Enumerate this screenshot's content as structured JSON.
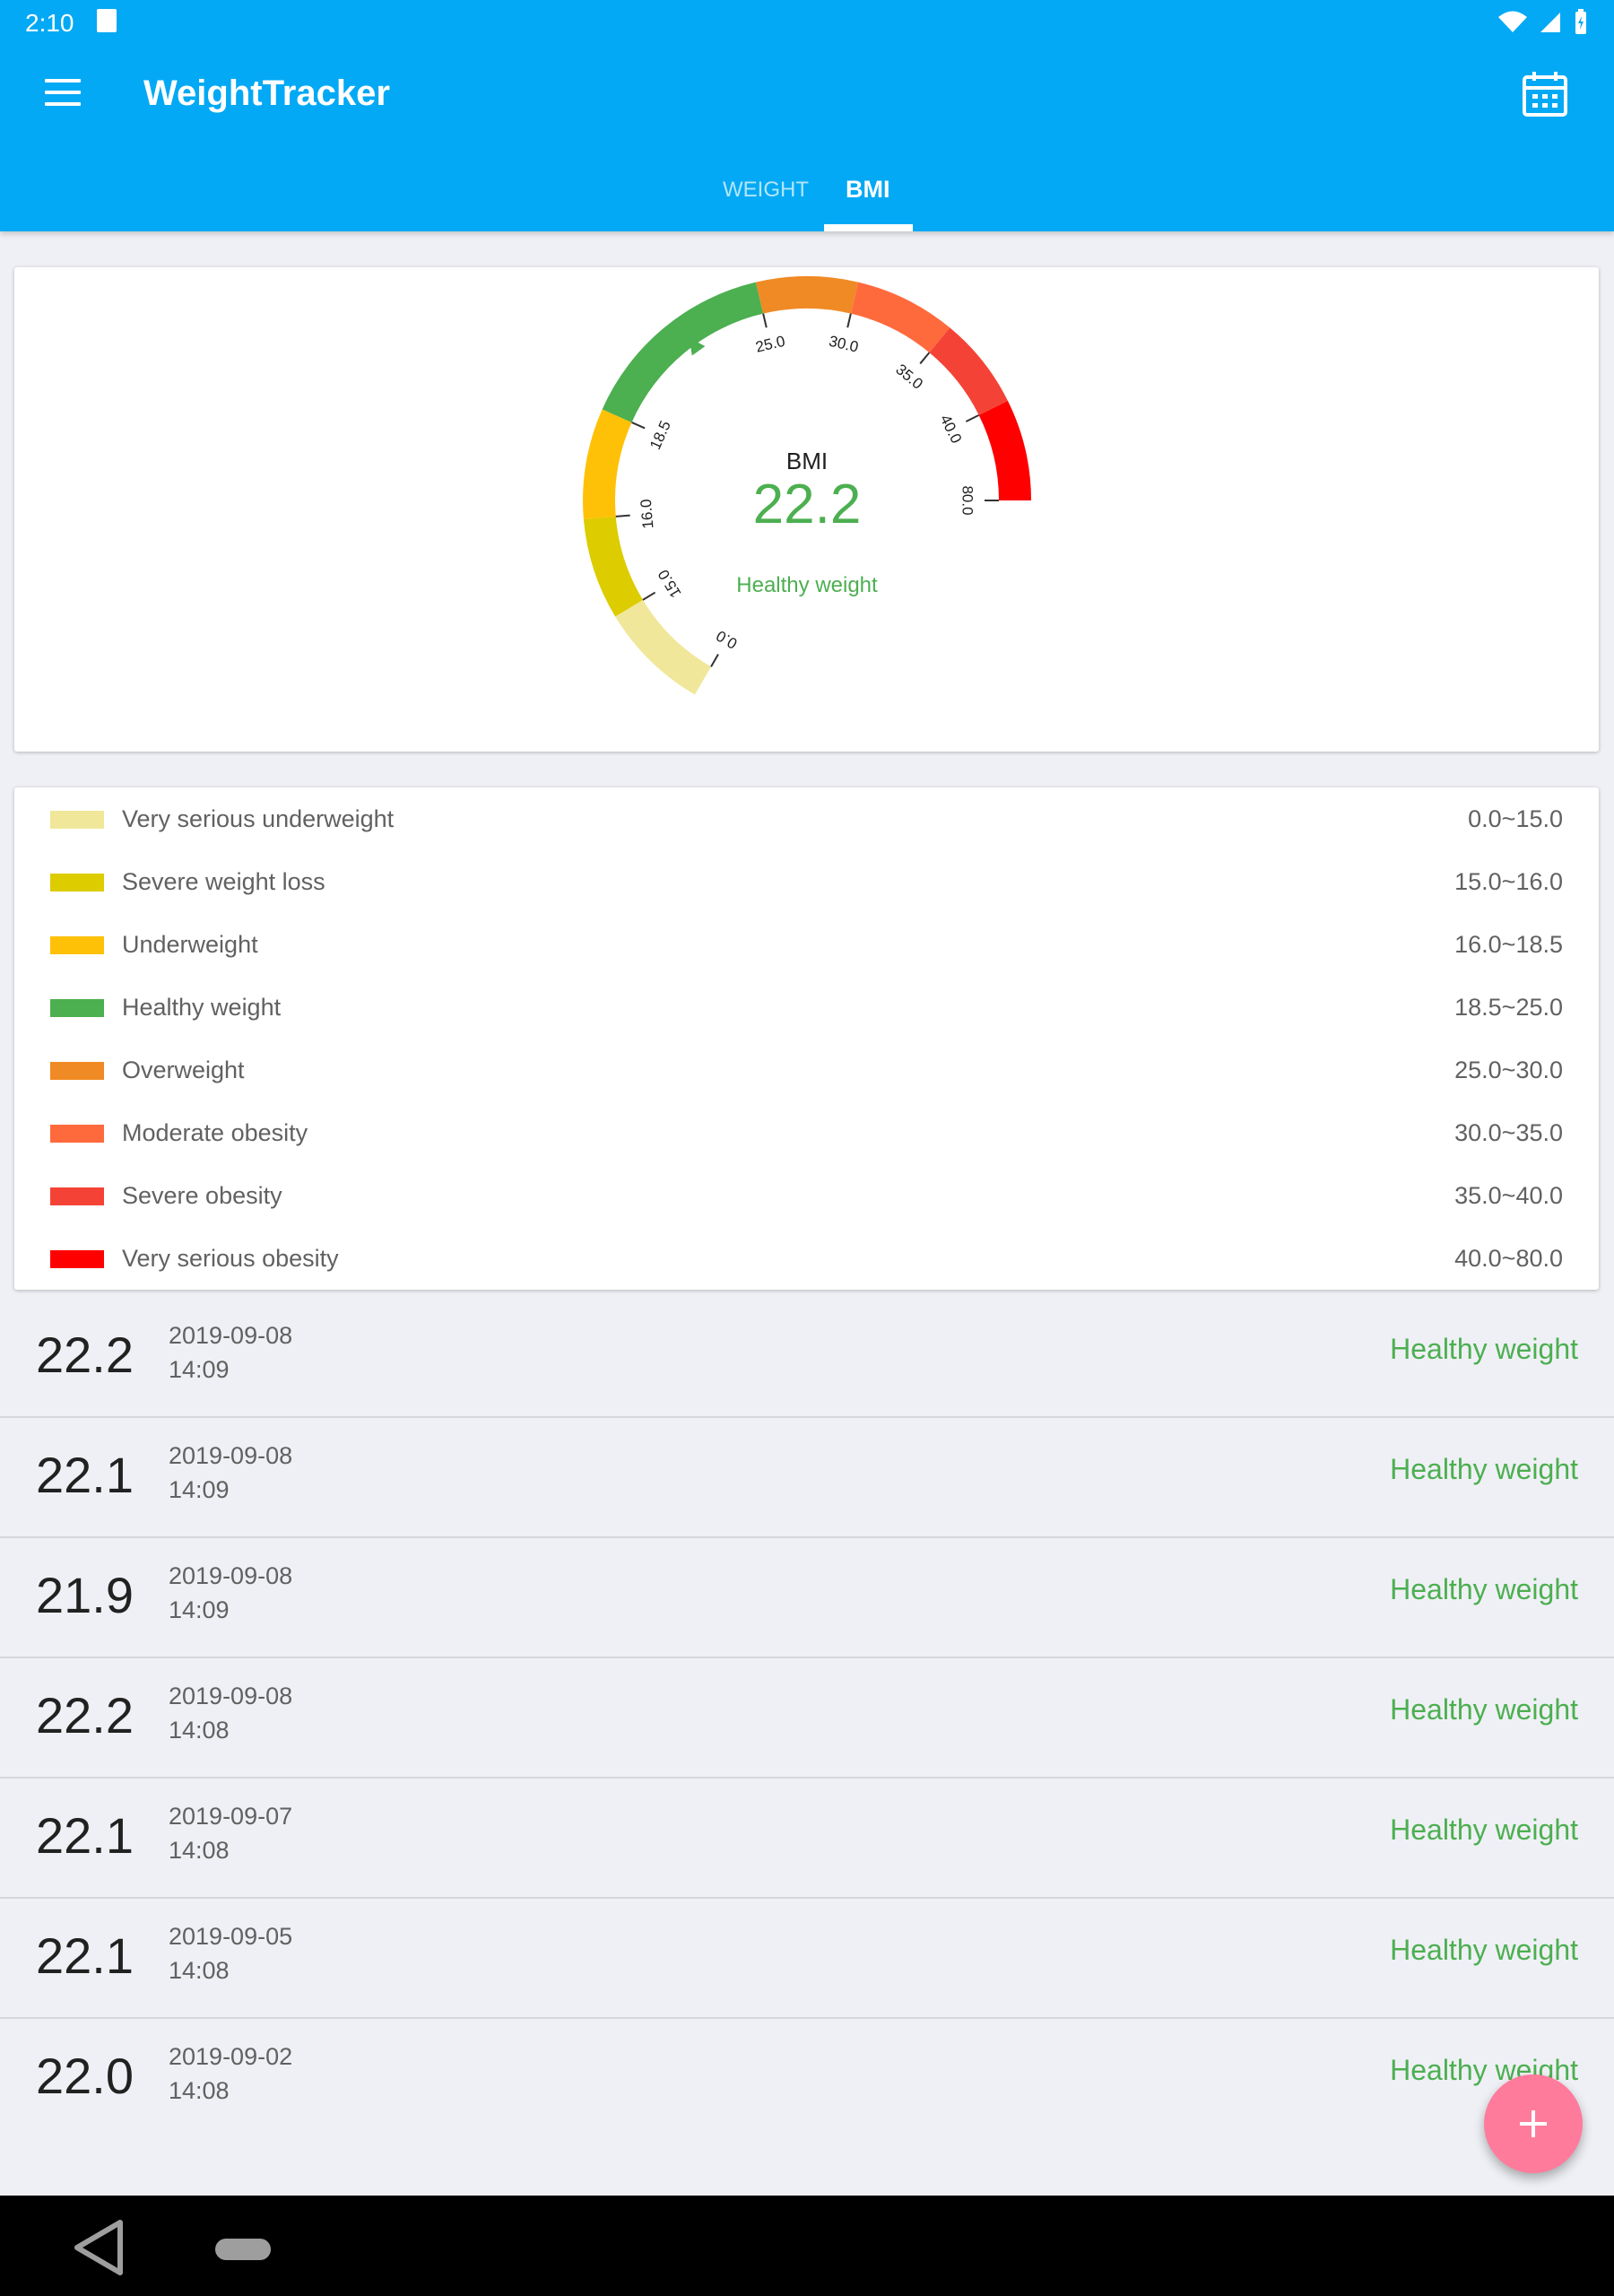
{
  "status_bar": {
    "time": "2:10"
  },
  "app": {
    "title": "WeightTracker"
  },
  "tabs": [
    {
      "label": "WEIGHT",
      "active": false
    },
    {
      "label": "BMI",
      "active": true
    }
  ],
  "gauge": {
    "label": "BMI",
    "value": "22.2",
    "status": "Healthy weight",
    "tick_labels": [
      "0.0",
      "15.0",
      "16.0",
      "18.5",
      "25.0",
      "30.0",
      "35.0",
      "40.0",
      "80.0"
    ]
  },
  "legend": [
    {
      "label": "Very serious underweight",
      "range": "0.0~15.0",
      "color": "#f0e79a"
    },
    {
      "label": "Severe weight loss",
      "range": "15.0~16.0",
      "color": "#ddcc00"
    },
    {
      "label": "Underweight",
      "range": "16.0~18.5",
      "color": "#ffc107"
    },
    {
      "label": "Healthy weight",
      "range": "18.5~25.0",
      "color": "#4caf50"
    },
    {
      "label": "Overweight",
      "range": "25.0~30.0",
      "color": "#f08a24"
    },
    {
      "label": "Moderate obesity",
      "range": "30.0~35.0",
      "color": "#ff6a3d"
    },
    {
      "label": "Severe obesity",
      "range": "35.0~40.0",
      "color": "#f44336"
    },
    {
      "label": "Very serious obesity",
      "range": "40.0~80.0",
      "color": "#ff0000"
    }
  ],
  "history": [
    {
      "value": "22.2",
      "date": "2019-09-08",
      "time": "14:09",
      "status": "Healthy weight"
    },
    {
      "value": "22.1",
      "date": "2019-09-08",
      "time": "14:09",
      "status": "Healthy weight"
    },
    {
      "value": "21.9",
      "date": "2019-09-08",
      "time": "14:09",
      "status": "Healthy weight"
    },
    {
      "value": "22.2",
      "date": "2019-09-08",
      "time": "14:08",
      "status": "Healthy weight"
    },
    {
      "value": "22.1",
      "date": "2019-09-07",
      "time": "14:08",
      "status": "Healthy weight"
    },
    {
      "value": "22.1",
      "date": "2019-09-05",
      "time": "14:08",
      "status": "Healthy weight"
    },
    {
      "value": "22.0",
      "date": "2019-09-02",
      "time": "14:08",
      "status": "Healthy weight"
    }
  ],
  "colors": {
    "primary": "#03a9f4",
    "accent": "#ff7b9c",
    "healthy": "#4caf50"
  },
  "icons": {
    "menu": "menu-icon",
    "calendar": "calendar-icon",
    "add": "plus-icon",
    "back": "back-icon",
    "home": "home-icon"
  }
}
